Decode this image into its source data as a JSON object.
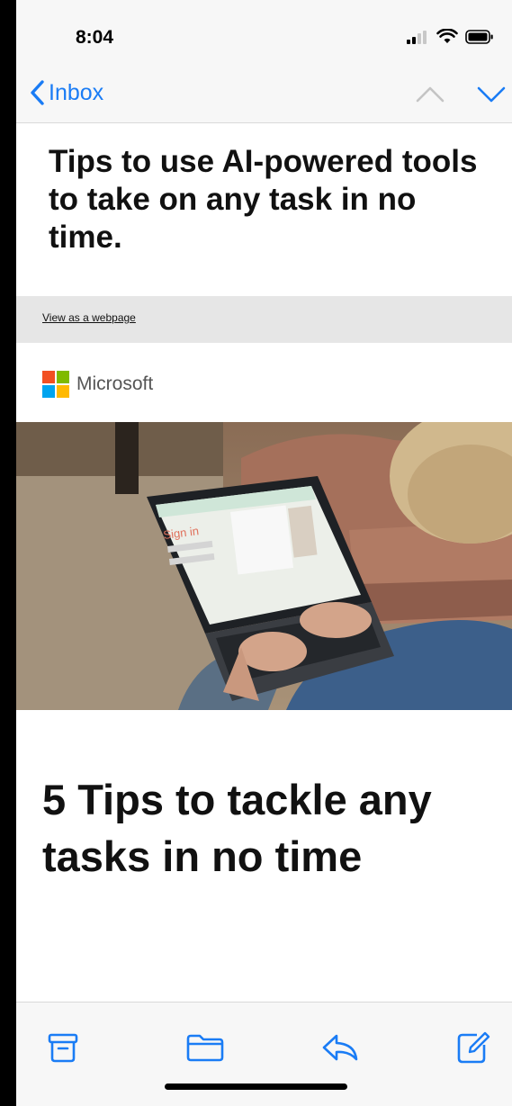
{
  "status_bar": {
    "time": "8:04"
  },
  "nav": {
    "back_label": "Inbox"
  },
  "email": {
    "subject": "Tips to use AI-powered tools to take on any task in no time.",
    "webview_link": "View as a webpage",
    "sender_logo_text": "Microsoft",
    "headline": "5 Tips to tackle any tasks in no time",
    "hero_screen_text": "Sign in"
  },
  "colors": {
    "accent": "#1a7cf5",
    "ms_red": "#f25022",
    "ms_green": "#7fba00",
    "ms_blue": "#00a4ef",
    "ms_yellow": "#ffb900"
  },
  "toolbar": {
    "icons": [
      "archive-icon",
      "folder-icon",
      "reply-icon",
      "compose-icon"
    ]
  }
}
